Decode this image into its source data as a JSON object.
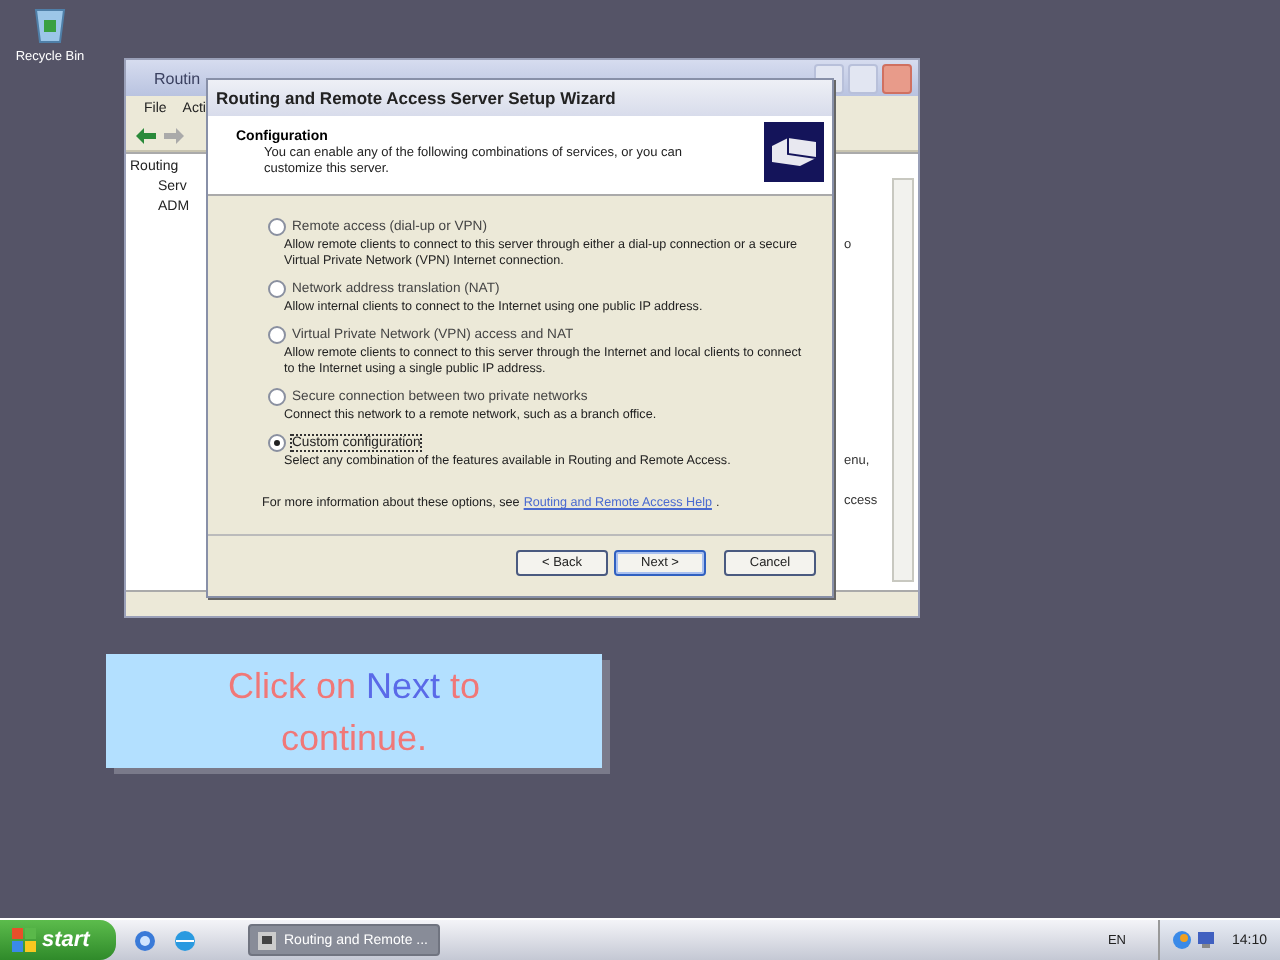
{
  "desktop_icons": [
    {
      "label": "Recycle Bin"
    }
  ],
  "background_window": {
    "title": "Routin",
    "menu": [
      "File",
      "Acti"
    ],
    "tree": [
      "Routing",
      "Serv",
      "ADM"
    ],
    "right_pane_fragments": [
      "o",
      "enu,",
      "ccess"
    ]
  },
  "wizard": {
    "title": "Routing and Remote Access Server Setup Wizard",
    "header_title": "Configuration",
    "header_subtitle": "You can enable any of the following combinations of services, or you can customize this server.",
    "options": [
      {
        "label": "Remote access (dial-up or VPN)",
        "description": "Allow remote clients to connect to this server through either a dial-up connection or a secure Virtual Private Network (VPN) Internet connection.",
        "selected": false
      },
      {
        "label": "Network address translation (NAT)",
        "description": "Allow internal clients to connect to the Internet using one public IP address.",
        "selected": false
      },
      {
        "label": "Virtual Private Network (VPN) access and NAT",
        "description": "Allow remote clients to connect to this server through the Internet and local clients to connect to the Internet using a single public IP address.",
        "selected": false
      },
      {
        "label": "Secure connection between two private networks",
        "description": "Connect this network to a remote network, such as a branch office.",
        "selected": false
      },
      {
        "label": "Custom configuration",
        "description": "Select any combination of the features available in Routing and Remote Access.",
        "selected": true
      }
    ],
    "help_text": "For more information about these options, see",
    "help_link": "Routing and Remote Access Help",
    "help_end": ".",
    "buttons": [
      "< Back",
      "Next >",
      "Cancel"
    ]
  },
  "callout": {
    "before": "Click on ",
    "highlight": "Next",
    "after": " to continue."
  },
  "taskbar": {
    "start": "start",
    "task": "Routing and Remote ...",
    "language": "EN",
    "clock": "14:10"
  }
}
